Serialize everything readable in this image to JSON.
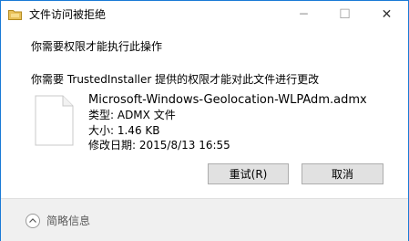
{
  "window": {
    "title": "文件访问被拒绝",
    "icon": "folder-warning-icon",
    "controls": {
      "minimize": "─",
      "maximize": "☐",
      "close": "✕"
    }
  },
  "dialog": {
    "heading": "你需要权限才能执行此操作",
    "message": "你需要 TrustedInstaller 提供的权限才能对此文件进行更改"
  },
  "file": {
    "icon": "document-icon",
    "name": "Microsoft-Windows-Geolocation-WLPAdm.admx",
    "type_label": "类型: ADMX 文件",
    "size_label": "大小: 1.46 KB",
    "date_label": "修改日期: 2015/8/13 16:55"
  },
  "buttons": {
    "retry_label": "重试(R)",
    "cancel_label": "取消"
  },
  "footer": {
    "details_label": "简略信息",
    "details_icon": "chevron-up-circle-icon"
  },
  "colors": {
    "window_border": "#1a7ad6",
    "button_bg": "#e1e1e1",
    "footer_bg": "#f0f0f0"
  }
}
